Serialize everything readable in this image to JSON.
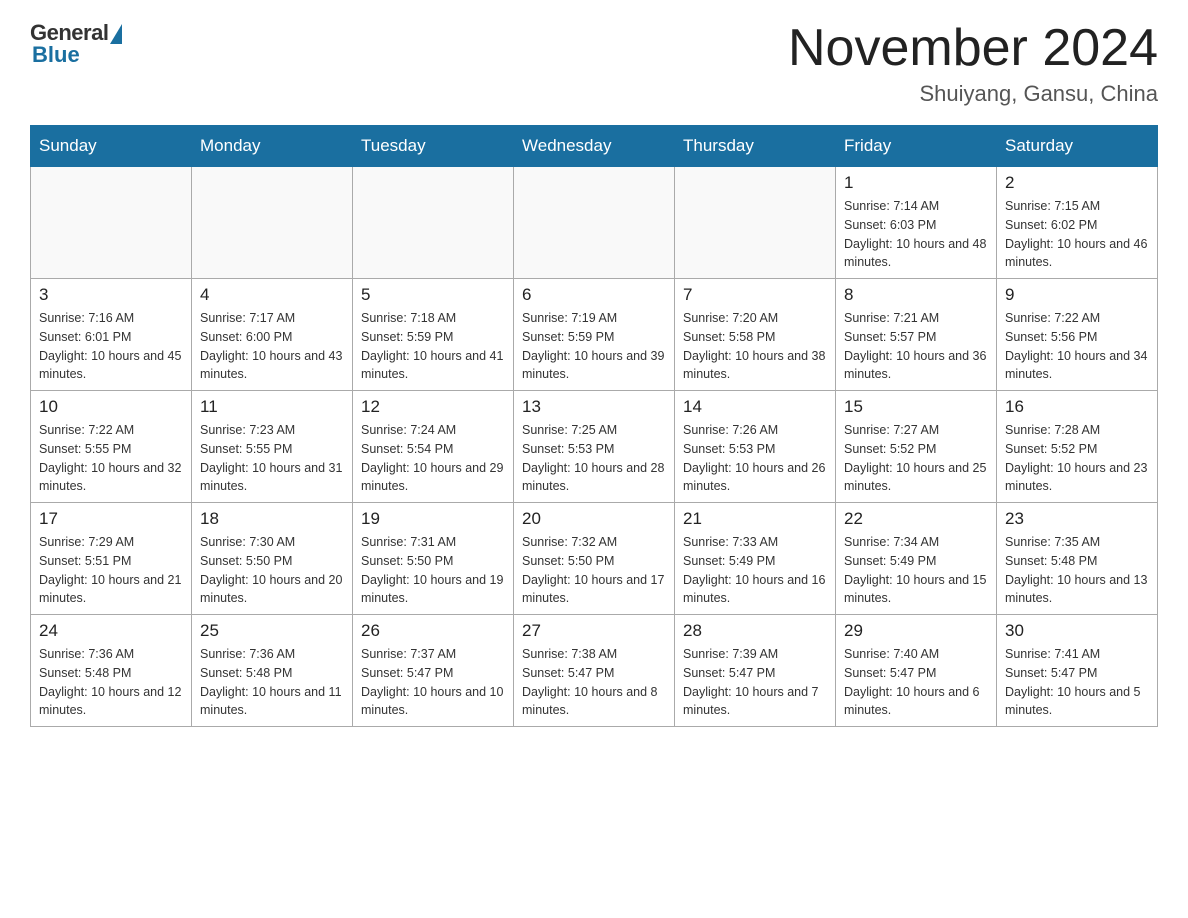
{
  "header": {
    "logo_general": "General",
    "logo_blue": "Blue",
    "month_title": "November 2024",
    "location": "Shuiyang, Gansu, China"
  },
  "weekdays": [
    "Sunday",
    "Monday",
    "Tuesday",
    "Wednesday",
    "Thursday",
    "Friday",
    "Saturday"
  ],
  "weeks": [
    [
      {
        "day": "",
        "info": ""
      },
      {
        "day": "",
        "info": ""
      },
      {
        "day": "",
        "info": ""
      },
      {
        "day": "",
        "info": ""
      },
      {
        "day": "",
        "info": ""
      },
      {
        "day": "1",
        "info": "Sunrise: 7:14 AM\nSunset: 6:03 PM\nDaylight: 10 hours and 48 minutes."
      },
      {
        "day": "2",
        "info": "Sunrise: 7:15 AM\nSunset: 6:02 PM\nDaylight: 10 hours and 46 minutes."
      }
    ],
    [
      {
        "day": "3",
        "info": "Sunrise: 7:16 AM\nSunset: 6:01 PM\nDaylight: 10 hours and 45 minutes."
      },
      {
        "day": "4",
        "info": "Sunrise: 7:17 AM\nSunset: 6:00 PM\nDaylight: 10 hours and 43 minutes."
      },
      {
        "day": "5",
        "info": "Sunrise: 7:18 AM\nSunset: 5:59 PM\nDaylight: 10 hours and 41 minutes."
      },
      {
        "day": "6",
        "info": "Sunrise: 7:19 AM\nSunset: 5:59 PM\nDaylight: 10 hours and 39 minutes."
      },
      {
        "day": "7",
        "info": "Sunrise: 7:20 AM\nSunset: 5:58 PM\nDaylight: 10 hours and 38 minutes."
      },
      {
        "day": "8",
        "info": "Sunrise: 7:21 AM\nSunset: 5:57 PM\nDaylight: 10 hours and 36 minutes."
      },
      {
        "day": "9",
        "info": "Sunrise: 7:22 AM\nSunset: 5:56 PM\nDaylight: 10 hours and 34 minutes."
      }
    ],
    [
      {
        "day": "10",
        "info": "Sunrise: 7:22 AM\nSunset: 5:55 PM\nDaylight: 10 hours and 32 minutes."
      },
      {
        "day": "11",
        "info": "Sunrise: 7:23 AM\nSunset: 5:55 PM\nDaylight: 10 hours and 31 minutes."
      },
      {
        "day": "12",
        "info": "Sunrise: 7:24 AM\nSunset: 5:54 PM\nDaylight: 10 hours and 29 minutes."
      },
      {
        "day": "13",
        "info": "Sunrise: 7:25 AM\nSunset: 5:53 PM\nDaylight: 10 hours and 28 minutes."
      },
      {
        "day": "14",
        "info": "Sunrise: 7:26 AM\nSunset: 5:53 PM\nDaylight: 10 hours and 26 minutes."
      },
      {
        "day": "15",
        "info": "Sunrise: 7:27 AM\nSunset: 5:52 PM\nDaylight: 10 hours and 25 minutes."
      },
      {
        "day": "16",
        "info": "Sunrise: 7:28 AM\nSunset: 5:52 PM\nDaylight: 10 hours and 23 minutes."
      }
    ],
    [
      {
        "day": "17",
        "info": "Sunrise: 7:29 AM\nSunset: 5:51 PM\nDaylight: 10 hours and 21 minutes."
      },
      {
        "day": "18",
        "info": "Sunrise: 7:30 AM\nSunset: 5:50 PM\nDaylight: 10 hours and 20 minutes."
      },
      {
        "day": "19",
        "info": "Sunrise: 7:31 AM\nSunset: 5:50 PM\nDaylight: 10 hours and 19 minutes."
      },
      {
        "day": "20",
        "info": "Sunrise: 7:32 AM\nSunset: 5:50 PM\nDaylight: 10 hours and 17 minutes."
      },
      {
        "day": "21",
        "info": "Sunrise: 7:33 AM\nSunset: 5:49 PM\nDaylight: 10 hours and 16 minutes."
      },
      {
        "day": "22",
        "info": "Sunrise: 7:34 AM\nSunset: 5:49 PM\nDaylight: 10 hours and 15 minutes."
      },
      {
        "day": "23",
        "info": "Sunrise: 7:35 AM\nSunset: 5:48 PM\nDaylight: 10 hours and 13 minutes."
      }
    ],
    [
      {
        "day": "24",
        "info": "Sunrise: 7:36 AM\nSunset: 5:48 PM\nDaylight: 10 hours and 12 minutes."
      },
      {
        "day": "25",
        "info": "Sunrise: 7:36 AM\nSunset: 5:48 PM\nDaylight: 10 hours and 11 minutes."
      },
      {
        "day": "26",
        "info": "Sunrise: 7:37 AM\nSunset: 5:47 PM\nDaylight: 10 hours and 10 minutes."
      },
      {
        "day": "27",
        "info": "Sunrise: 7:38 AM\nSunset: 5:47 PM\nDaylight: 10 hours and 8 minutes."
      },
      {
        "day": "28",
        "info": "Sunrise: 7:39 AM\nSunset: 5:47 PM\nDaylight: 10 hours and 7 minutes."
      },
      {
        "day": "29",
        "info": "Sunrise: 7:40 AM\nSunset: 5:47 PM\nDaylight: 10 hours and 6 minutes."
      },
      {
        "day": "30",
        "info": "Sunrise: 7:41 AM\nSunset: 5:47 PM\nDaylight: 10 hours and 5 minutes."
      }
    ]
  ]
}
